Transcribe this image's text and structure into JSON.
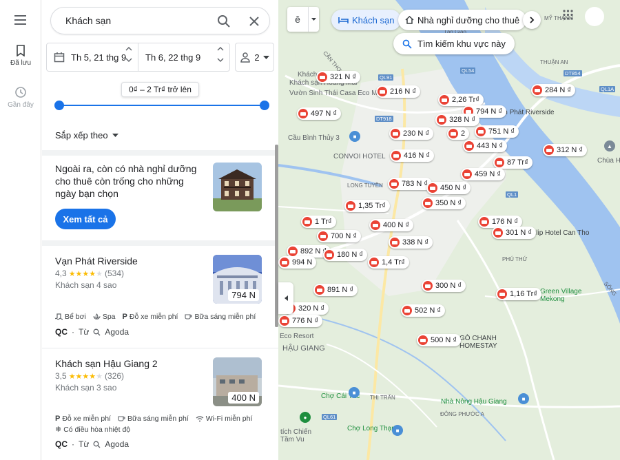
{
  "rail": {
    "saved_label": "Đã lưu",
    "recent_label": "Gần đây"
  },
  "search": {
    "value": "Khách sạn"
  },
  "dates": {
    "checkin": "Th 5, 21 thg 9",
    "checkout": "Th 6, 22 thg 9"
  },
  "guests": {
    "count": "2"
  },
  "price_filter": {
    "tooltip": "0₫ – 2 Tr₫ trở lên",
    "min_fraction": 0.0,
    "max_fraction": 1.0
  },
  "sort": {
    "label": "Sắp xếp theo"
  },
  "promo": {
    "text": "Ngoài ra, còn có nhà nghỉ dưỡng cho thuê còn trống cho những ngày bạn chọn",
    "button": "Xem tất cả"
  },
  "hotels": [
    {
      "name": "Vạn Phát Riverside",
      "rating": "4,3",
      "stars": 4.3,
      "reviews": "(534)",
      "class": "Khách sạn 4 sao",
      "price": "794 N",
      "amenities": [
        "Bể bơi",
        "Spa",
        "Đỗ xe miễn phí",
        "Bữa sáng miễn phí"
      ],
      "ad": "QC",
      "from": "Từ",
      "source": "Agoda"
    },
    {
      "name": "Khách sạn Hậu Giang 2",
      "rating": "3,5",
      "stars": 3.5,
      "reviews": "(326)",
      "class": "Khách sạn 3 sao",
      "price": "400 N",
      "amenities": [
        "Đỗ xe miễn phí",
        "Bữa sáng miễn phí",
        "Wi-Fi miễn phí"
      ],
      "amenities2": [
        "Có điều hòa nhiệt độ"
      ],
      "ad": "QC",
      "from": "Từ",
      "source": "Agoda"
    }
  ],
  "map": {
    "chips": [
      "Khách sạn",
      "Nhà nghỉ dưỡng cho thuê"
    ],
    "search_area": "Tìm kiếm khu vực này",
    "pins": [
      "321 N ₫",
      "216 N ₫",
      "2,26 Tr₫",
      "794 N ₫",
      "284 N ₫",
      "497 N ₫",
      "328 N ₫",
      "751 N ₫",
      "230 N ₫",
      "2",
      "443 N ₫",
      "312 N ₫",
      "416 N ₫",
      "87 Tr₫",
      "459 N ₫",
      "783 N ₫",
      "450 N ₫",
      "350 N ₫",
      "1,35 Tr₫",
      "176 N ₫",
      "1 Tr₫",
      "400 N ₫",
      "301 N ₫",
      "700 N ₫",
      "338 N ₫",
      "892 N ₫",
      "180 N ₫",
      "994 N",
      "1,4 Tr₫",
      "300 N ₫",
      "891 N ₫",
      "1,16 Tr₫",
      "320 N ₫",
      "502 N ₫",
      "776 N ₫",
      "500 N ₫"
    ],
    "places": [
      "Khách sạn Hoàng Mai",
      "Vườn Sinh Thái Casa Eco Mekong",
      "Cầu Bình Thủy 3",
      "CONVOI HOTEL",
      "LONG TUYỀN",
      "Vạn Phát Riverside",
      "Chùa H",
      "Tulip Hotel Can Tho",
      "PHÚ THỨ",
      "Green Village Mekong",
      "GÒ CHANH HOMESTAY",
      "Eco Resort",
      "HẬU GIANG",
      "Chợ Cái Tắc",
      "THỊ TRẤN",
      "Nhà Nông Hậu Giang",
      "ĐÔNG PHƯỚC A",
      "Chợ Long Thạnh",
      "tích Chiến Tầm Vu",
      "CẦN THƠ",
      "SÔNG",
      "THUẬN AN",
      "MỸ THẠNH",
      "Tân Giao"
    ],
    "roads": [
      "QL91",
      "DT918",
      "QL54",
      "DT854",
      "QL1A",
      "QL1",
      "QL61"
    ]
  }
}
